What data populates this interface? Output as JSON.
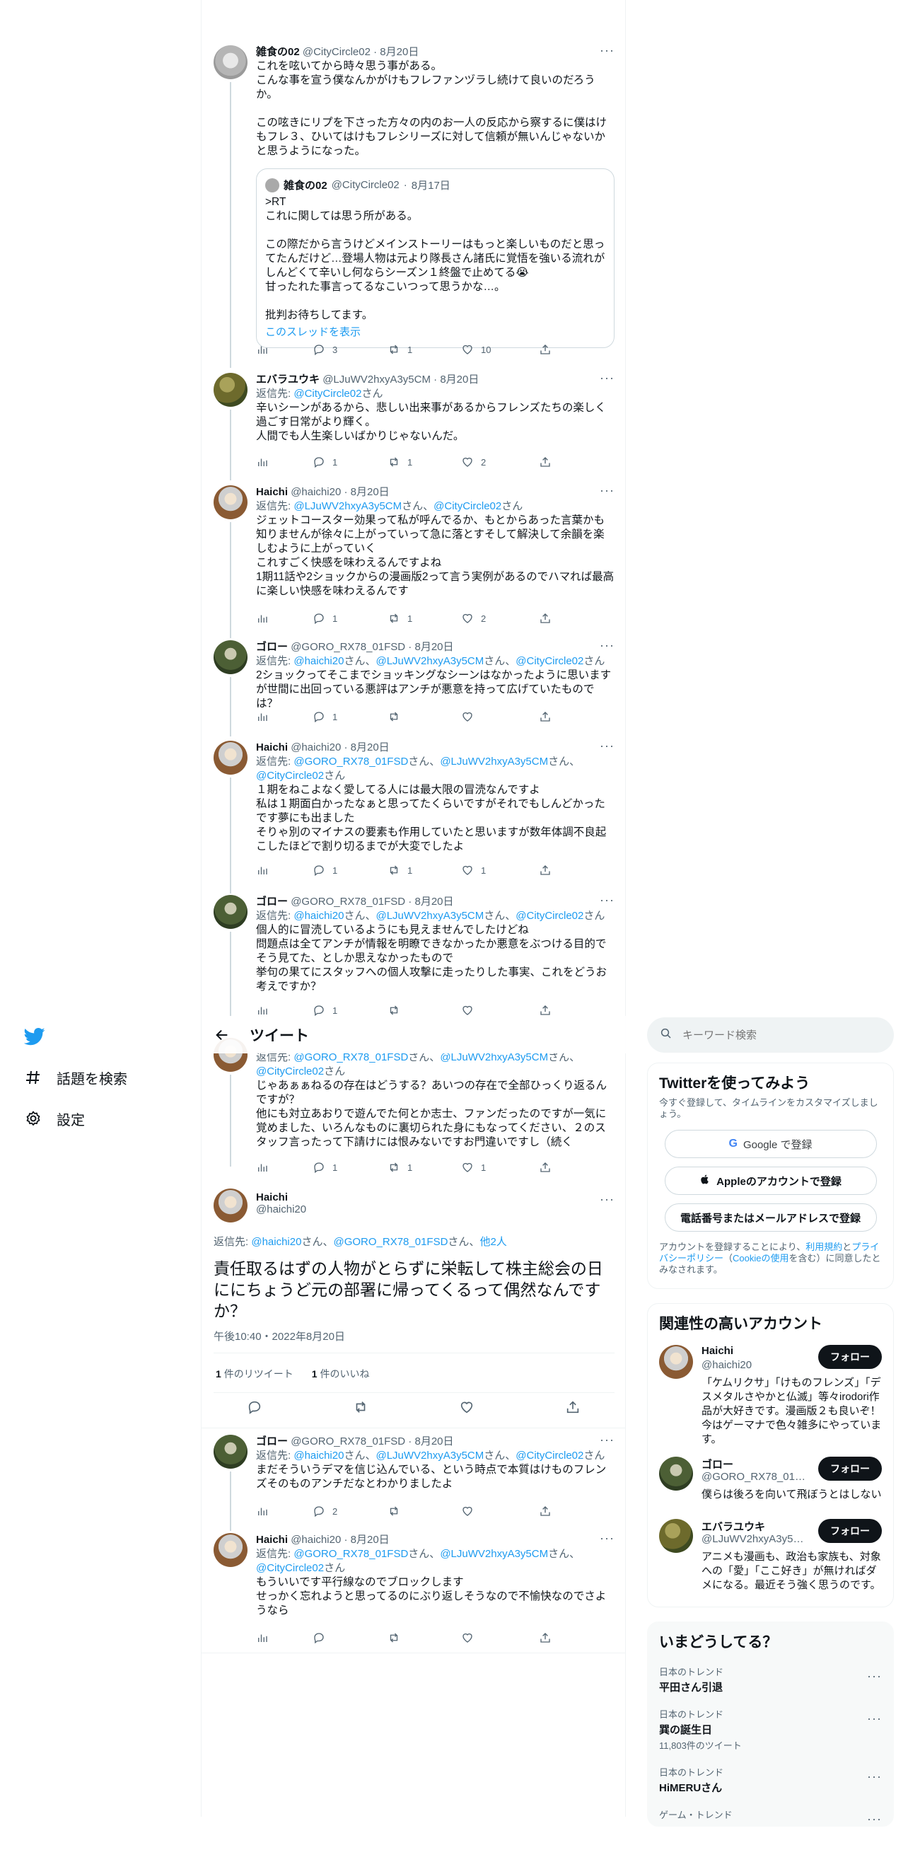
{
  "nav": {
    "explore": "話題を検索",
    "settings": "設定"
  },
  "header": {
    "title": "ツイート"
  },
  "tweets": [
    {
      "name": "雑食の02",
      "handle": "@CityCircle02",
      "date": "8月20日",
      "text": "これを呟いてから時々思う事がある。\nこんな事を宣う僕なんかがけもフレファンヅラし続けて良いのだろうか。\n\nこの呟きにリプを下さった方々の内のお一人の反応から察するに僕はけもフレ３、ひいてはけもフレシリーズに対して信頼が無いんじゃないかと思うようになった。",
      "quote": {
        "name": "雑食の02",
        "handle": "@CityCircle02",
        "date": "8月17日",
        "text": ">RT\nこれに関しては思う所がある。\n\nこの際だから言うけどメインストーリーはもっと楽しいものだと思ってたんだけど…登場人物は元より隊長さん諸氏に覚悟を強いる流れがしんどくて辛いし何ならシーズン１終盤で止めてる😭\n甘ったれた事言ってるなこいつって思うかな…。\n\n批判お待ちしてます。",
        "link": "このスレッドを表示"
      },
      "replies": "3",
      "retweets": "1",
      "likes": "10"
    },
    {
      "name": "エバラユウキ",
      "handle": "@LJuWV2hxyA3y5CM",
      "date": "8月20日",
      "reply_prefix": "返信先: ",
      "reply_to": [
        "@CityCircle02"
      ],
      "reply_suffix": "さん",
      "text": "辛いシーンがあるから、悲しい出来事があるからフレンズたちの楽しく過ごす日常がより輝く。\n人間でも人生楽しいばかりじゃないんだ。",
      "replies": "1",
      "retweets": "1",
      "likes": "2"
    },
    {
      "name": "Haichi",
      "handle": "@haichi20",
      "date": "8月20日",
      "reply_to_text": [
        "@LJuWV2hxyA3y5CM",
        "さん、",
        "@CityCircle02",
        "さん"
      ],
      "text": "ジェットコースター効果って私が呼んでるか、もとからあった言葉かも知りませんが徐々に上がっていって急に落とすそして解決して余韻を楽しむように上がっていく\nこれすごく快感を味わえるんですよね\n1期11話や2ショックからの漫画版2って言う実例があるのでハマれば最高に楽しい快感を味わえるんです",
      "replies": "1",
      "retweets": "1",
      "likes": "2"
    },
    {
      "name": "ゴロー",
      "handle": "@GORO_RX78_01FSD",
      "date": "8月20日",
      "reply_to_text": [
        "@haichi20",
        "さん、",
        "@LJuWV2hxyA3y5CM",
        "さん、",
        "@CityCircle02",
        "さん"
      ],
      "text": "2ショックってそこまでショッキングなシーンはなかったように思いますが世間に出回っている悪評はアンチが悪意を持って広げていたものでは？",
      "replies": "1",
      "retweets": "",
      "likes": ""
    },
    {
      "name": "Haichi",
      "handle": "@haichi20",
      "date": "8月20日",
      "reply_to_text": [
        "@GORO_RX78_01FSD",
        "さん、",
        "@LJuWV2hxyA3y5CM",
        "さん、",
        "@CityCircle02",
        "さん"
      ],
      "text": "１期をねこよなく愛してる人には最大限の冒涜なんですよ\n私は１期面白かったなぁと思ってたくらいですがそれでもしんどかったです夢にも出ました\nそりゃ別のマイナスの要素も作用していたと思いますが数年体調不良起こしたほどで割り切るまでが大変でしたよ",
      "replies": "1",
      "retweets": "1",
      "likes": "1"
    },
    {
      "name": "ゴロー",
      "handle": "@GORO_RX78_01FSD",
      "date": "8月20日",
      "reply_to_text": [
        "@haichi20",
        "さん、",
        "@LJuWV2hxyA3y5CM",
        "さん、",
        "@CityCircle02",
        "さん"
      ],
      "text": "個人的に冒涜しているようにも見えませんでしたけどね\n問題点は全てアンチが情報を明瞭できなかったか悪意をぶつける目的でそう見てた、としか思えなかったもので\n挙句の果てにスタッフへの個人攻撃に走ったりした事実、これをどうお考えですか？",
      "replies": "1",
      "retweets": "",
      "likes": ""
    },
    {
      "name": "Haichi",
      "handle": "@haichi20",
      "date": "8月20日",
      "reply_to_text": [
        "@GORO_RX78_01FSD",
        "さん、",
        "@LJuWV2hxyA3y5CM",
        "さん、",
        "@CityCircle02",
        "さん"
      ],
      "text": "じゃあぁぁねるの存在はどうする？あいつの存在で全部ひっくり返るんですが？\n他にも対立あおりで遊んでた何とか志士、ファンだったのですが一気に覚めました、いろんなものに裏切られた身にもなってください、２のスタッフ言ったって下請けには恨みないですお門違いですし（続く",
      "replies": "1",
      "retweets": "1",
      "likes": "1"
    }
  ],
  "focus": {
    "name": "Haichi",
    "handle": "@haichi20",
    "reply_prefix": "返信先: ",
    "reply_a": "@haichi20",
    "reply_b": "@GORO_RX78_01FSD",
    "reply_others": "他2人",
    "text": "責任取るはずの人物がとらずに栄転して株主総会の日ににちょうど元の部署に帰ってくるって偶然なんですか？",
    "time": "午後10:40・2022年8月20日",
    "retweets_count": "1",
    "retweets_label": "件のリツイート",
    "likes_count": "1",
    "likes_label": "件のいいね"
  },
  "after": [
    {
      "name": "ゴロー",
      "handle": "@GORO_RX78_01FSD",
      "date": "8月20日",
      "reply_to_text": [
        "@haichi20",
        "さん、",
        "@LJuWV2hxyA3y5CM",
        "さん、",
        "@CityCircle02",
        "さん"
      ],
      "text": "まだそういうデマを信じ込んでいる、という時点で本質はけものフレンズそのものアンチだなとわかりましたよ",
      "replies": "2",
      "retweets": "",
      "likes": ""
    },
    {
      "name": "Haichi",
      "handle": "@haichi20",
      "date": "8月20日",
      "reply_to_text": [
        "@GORO_RX78_01FSD",
        "さん、",
        "@LJuWV2hxyA3y5CM",
        "さん、",
        "@CityCircle02",
        "さん"
      ],
      "text": "もういいです平行線なのでブロックします\nせっかく忘れようと思ってるのにぶり返しそうなので不愉快なのでさようなら",
      "replies": "",
      "retweets": "",
      "likes": ""
    }
  ],
  "search": {
    "placeholder": "キーワード検索"
  },
  "signup": {
    "title": "Twitterを使ってみよう",
    "subtitle": "今すぐ登録して、タイムラインをカスタマイズしましょう。",
    "google": "Google で登録",
    "apple": "Appleのアカウントで登録",
    "phone": "電話番号またはメールアドレスで登録",
    "legal_a": "アカウントを登録することにより、",
    "legal_terms": "利用規約",
    "legal_and": "と",
    "legal_privacy": "プライバシーポリシー",
    "legal_b": "（",
    "legal_cookie": "Cookieの使用",
    "legal_c": "を含む）に同意したとみなされます。"
  },
  "relevant": {
    "title": "関連性の高いアカウント",
    "follow": "フォロー",
    "accounts": [
      {
        "name": "Haichi",
        "handle": "@haichi20",
        "bio": "「ケムリクサ」「けものフレンズ」「デスメタルさやかと仏滅」等々irodori作品が大好きです。漫画版２も良いぞ！ 今はゲーマナで色々雑多にやっています。"
      },
      {
        "name": "ゴロー",
        "handle": "@GORO_RX78_01FSD",
        "bio": "僕らは後ろを向いて飛ぼうとはしない"
      },
      {
        "name": "エバラユウキ",
        "handle": "@LJuWV2hxyA3y5CM",
        "bio": "アニメも漫画も、政治も家族も、対象への「愛」「ここ好き」が無ければダメになる。最近そう強く思うのです。"
      }
    ]
  },
  "trends": {
    "title": "いまどうしてる？",
    "items": [
      {
        "category": "日本のトレンド",
        "name": "平田さん引退",
        "count": ""
      },
      {
        "category": "日本のトレンド",
        "name": "巽の誕生日",
        "count": "11,803件のツイート"
      },
      {
        "category": "日本のトレンド",
        "name": "HiMERUさん",
        "count": ""
      },
      {
        "category": "ゲーム・トレンド",
        "name": "",
        "count": ""
      }
    ]
  },
  "colors": {
    "accent": "#1d9bf0",
    "text": "#0f1419",
    "muted": "#536471"
  }
}
